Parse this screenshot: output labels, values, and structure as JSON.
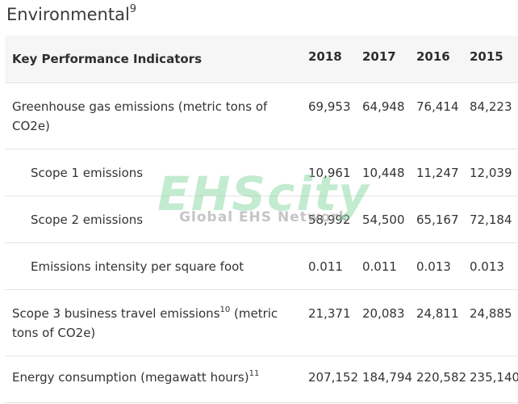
{
  "section": {
    "title": "Environmental",
    "title_note": "9"
  },
  "table": {
    "headers": [
      "Key Performance Indicators",
      "2018",
      "2017",
      "2016",
      "2015"
    ],
    "rows": [
      {
        "label": "Greenhouse gas emissions (metric tons of CO2e)",
        "values": [
          "69,953",
          "64,948",
          "76,414",
          "84,223"
        ]
      },
      {
        "label": "Scope 1 emissions",
        "values": [
          "10,961",
          "10,448",
          "11,247",
          "12,039"
        ]
      },
      {
        "label": "Scope 2 emissions",
        "values": [
          "58,992",
          "54,500",
          "65,167",
          "72,184"
        ]
      },
      {
        "label": "Emissions intensity per square foot",
        "values": [
          "0.011",
          "0.011",
          "0.013",
          "0.013"
        ]
      },
      {
        "label": "Scope 3 business travel emissions",
        "label_note": "10",
        "label_suffix": " (metric tons of CO2e)",
        "values": [
          "21,371",
          "20,083",
          "24,811",
          "24,885"
        ]
      },
      {
        "label": "Energy consumption (megawatt hours)",
        "label_note": "11",
        "values": [
          "207,152",
          "184,794",
          "220,582",
          "235,140"
        ]
      }
    ]
  },
  "watermark": {
    "brand": "EHScity",
    "tagline": "Global EHS Network"
  }
}
